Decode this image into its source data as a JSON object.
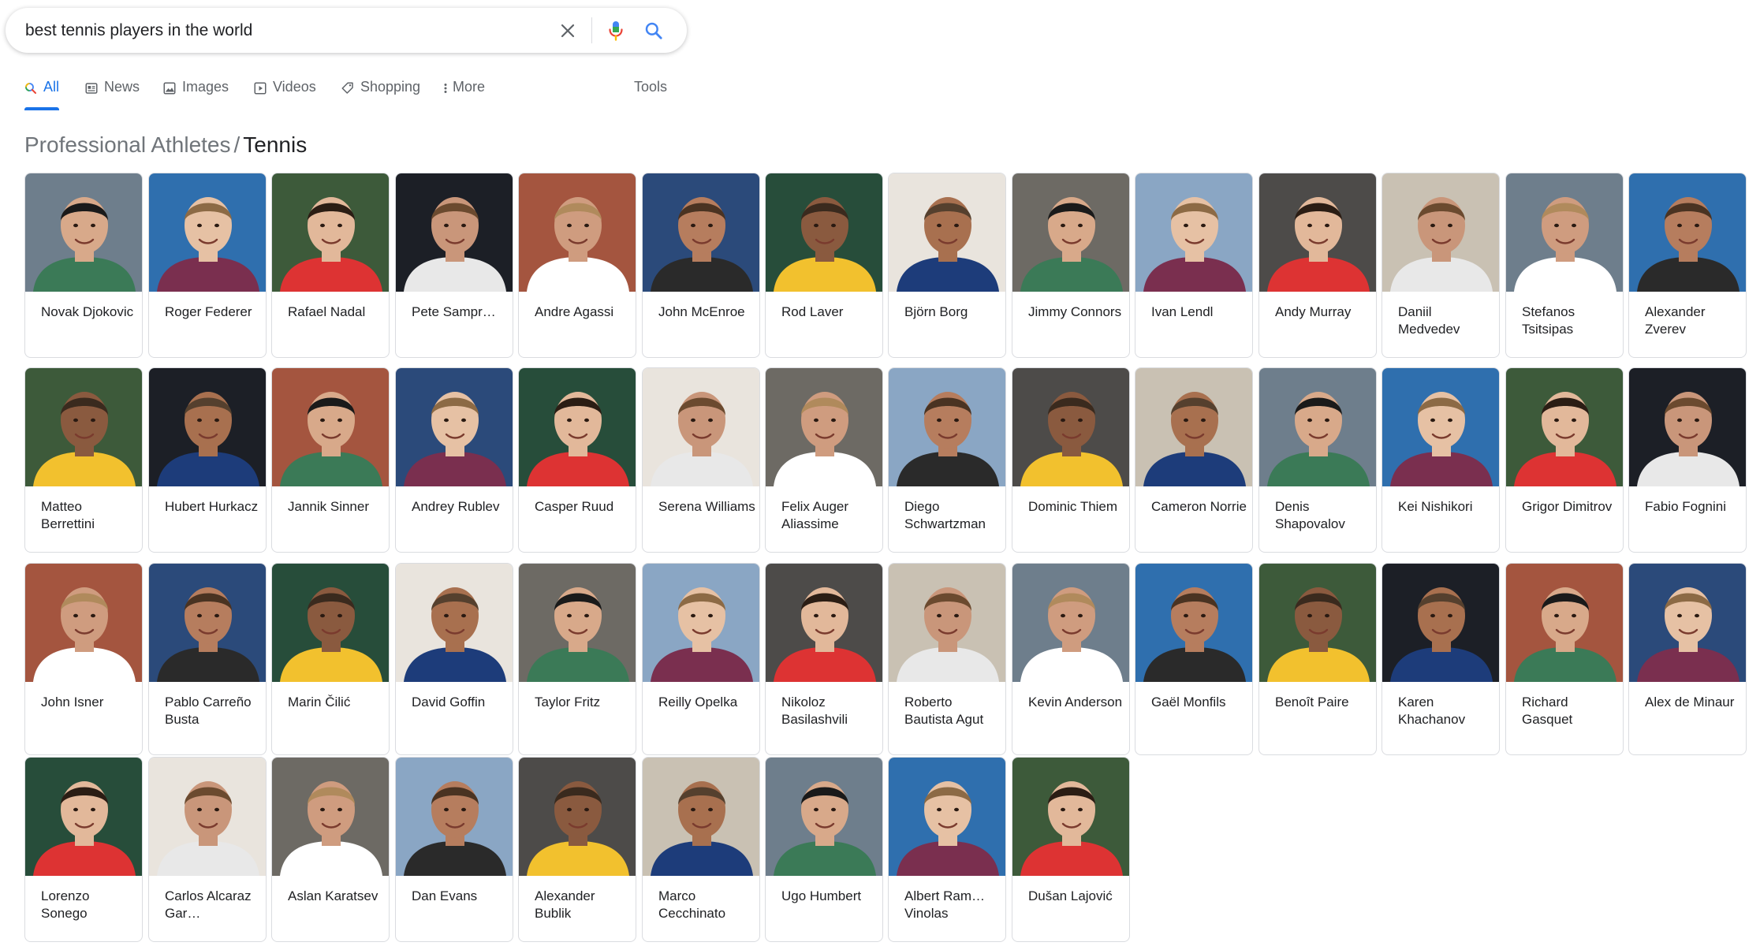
{
  "search": {
    "query": "best tennis players in the world",
    "clear_icon": "close-icon",
    "voice_icon": "microphone-icon",
    "search_icon": "search-icon"
  },
  "tabs": [
    {
      "label": "All",
      "icon": "search-icon",
      "active": true
    },
    {
      "label": "News",
      "icon": "news-icon",
      "active": false
    },
    {
      "label": "Images",
      "icon": "image-icon",
      "active": false
    },
    {
      "label": "Videos",
      "icon": "video-icon",
      "active": false
    },
    {
      "label": "Shopping",
      "icon": "tag-icon",
      "active": false
    },
    {
      "label": "More",
      "icon": "more-vert-icon",
      "active": false
    },
    {
      "label": "Tools",
      "icon": "",
      "active": false
    }
  ],
  "breadcrumb": {
    "parent": "Professional Athletes",
    "separator": "/",
    "current": "Tennis"
  },
  "colors": {
    "accent": "#1a73e8",
    "text": "#202124",
    "muted": "#70757a",
    "border": "#dadce0"
  },
  "players": [
    "Novak Djokovic",
    "Roger Federer",
    "Rafael Nadal",
    "Pete Sampr…",
    "Andre Agassi",
    "John McEnroe",
    "Rod Laver",
    "Björn Borg",
    "Jimmy Connors",
    "Ivan Lendl",
    "Andy Murray",
    "Daniil Medvedev",
    "Stefanos Tsitsipas",
    "Alexander Zverev",
    "Matteo Berrettini",
    "Hubert Hurkacz",
    "Jannik Sinner",
    "Andrey Rublev",
    "Casper Ruud",
    "Serena Williams",
    "Felix Auger Aliassime",
    "Diego Schwartzman",
    "Dominic Thiem",
    "Cameron Norrie",
    "Denis Shapovalov",
    "Kei Nishikori",
    "Grigor Dimitrov",
    "Fabio Fognini",
    "John Isner",
    "Pablo Carreño Busta",
    "Marin Čilić",
    "David Goffin",
    "Taylor Fritz",
    "Reilly Opelka",
    "Nikoloz Basilashvili",
    "Roberto Bautista Agut",
    "Kevin Anderson",
    "Gaël Monfils",
    "Benoît Paire",
    "Karen Khachanov",
    "Richard Gasquet",
    "Alex de Minaur",
    "Lorenzo Sonego",
    "Carlos Alcaraz Gar…",
    "Aslan Karatsev",
    "Dan Evans",
    "Alexander Bublik",
    "Marco Cecchinato",
    "Ugo Humbert",
    "Albert Ram… Vinolas",
    "Dušan Lajović"
  ]
}
